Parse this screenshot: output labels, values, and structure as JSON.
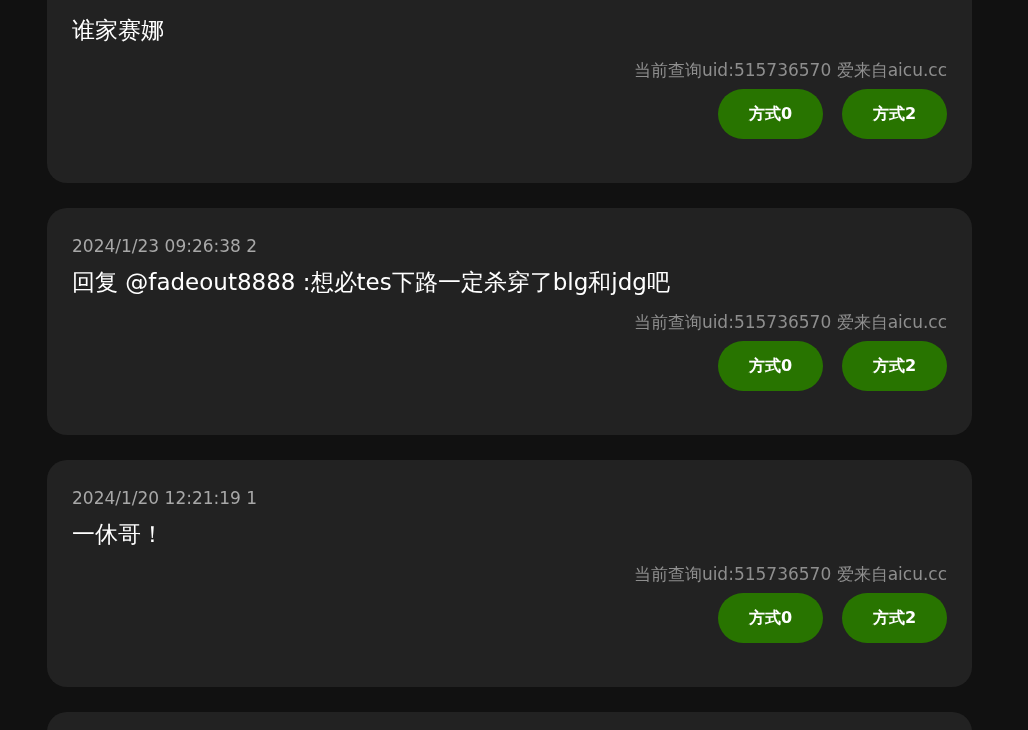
{
  "comments": [
    {
      "content": "谁家赛娜",
      "source": "当前查询uid:515736570 爱来自aicu.cc",
      "buttons": [
        "方式0",
        "方式2"
      ]
    },
    {
      "time": "2024/1/23 09:26:38 2",
      "content": "回复 @fadeout8888 :想必tes下路一定杀穿了blg和jdg吧",
      "source": "当前查询uid:515736570 爱来自aicu.cc",
      "buttons": [
        "方式0",
        "方式2"
      ]
    },
    {
      "time": "2024/1/20 12:21:19 1",
      "content": "一休哥！",
      "source": "当前查询uid:515736570 爱来自aicu.cc",
      "buttons": [
        "方式0",
        "方式2"
      ]
    }
  ]
}
